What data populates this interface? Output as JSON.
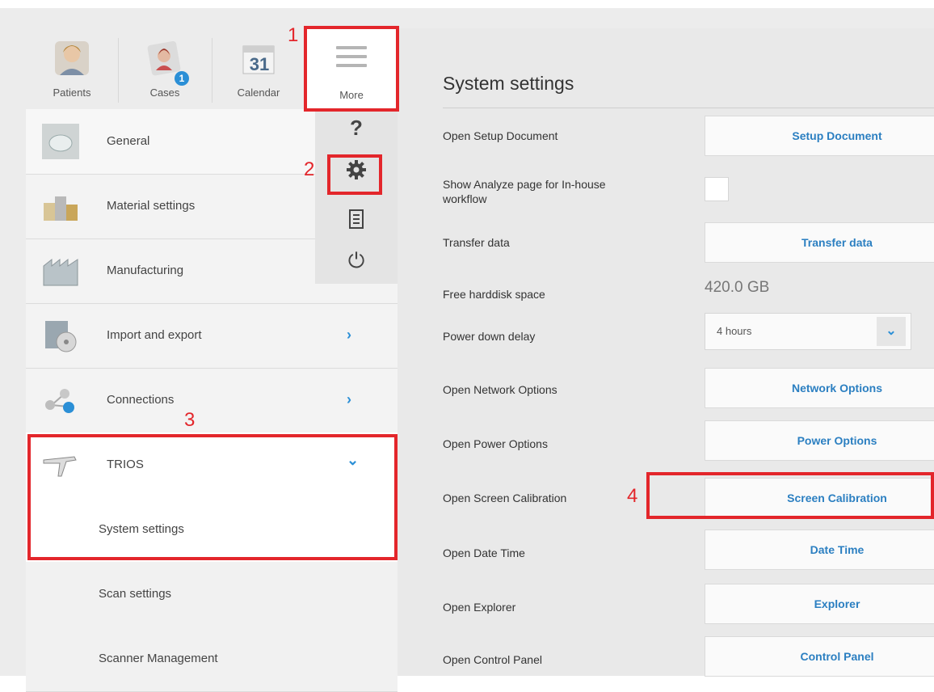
{
  "nav": {
    "patients": "Patients",
    "cases": "Cases",
    "cases_badge": "1",
    "calendar": "Calendar",
    "calendar_day": "31",
    "more": "More"
  },
  "flyout": {
    "help_glyph": "?",
    "settings_icon": "gear-icon",
    "log_icon": "document-icon",
    "power_glyph": "⏻"
  },
  "menu": [
    {
      "label": "General",
      "icon": "general-icon"
    },
    {
      "label": "Material settings",
      "icon": "materials-icon"
    },
    {
      "label": "Manufacturing",
      "icon": "factory-icon"
    },
    {
      "label": "Import and export",
      "icon": "import-export-icon",
      "chevron": "›"
    },
    {
      "label": "Connections",
      "icon": "connections-icon",
      "chevron": "›"
    },
    {
      "label": "TRIOS",
      "icon": "scanner-icon",
      "chevron": "⌄"
    }
  ],
  "submenu": [
    "System settings",
    "Scan settings",
    "Scanner Management"
  ],
  "settings": {
    "title": "System settings",
    "rows": [
      {
        "label": "Open Setup Document",
        "button": "Setup Document"
      },
      {
        "label": "Show Analyze page for In-house workflow"
      },
      {
        "label": "Transfer data",
        "button": "Transfer data"
      },
      {
        "label": "Free harddisk space",
        "value": "420.0 GB"
      },
      {
        "label": "Power down delay",
        "select": "4 hours"
      },
      {
        "label": "Open Network Options",
        "button": "Network Options"
      },
      {
        "label": "Open Power Options",
        "button": "Power Options"
      },
      {
        "label": "Open Screen Calibration",
        "button": "Screen Calibration"
      },
      {
        "label": "Open Date Time",
        "button": "Date Time"
      },
      {
        "label": "Open Explorer",
        "button": "Explorer"
      },
      {
        "label": "Open Control Panel",
        "button": "Control Panel"
      }
    ]
  },
  "annotations": [
    "1",
    "2",
    "3",
    "4"
  ],
  "colors": {
    "accent": "#2b8fd6",
    "annotation": "#e3262b"
  }
}
